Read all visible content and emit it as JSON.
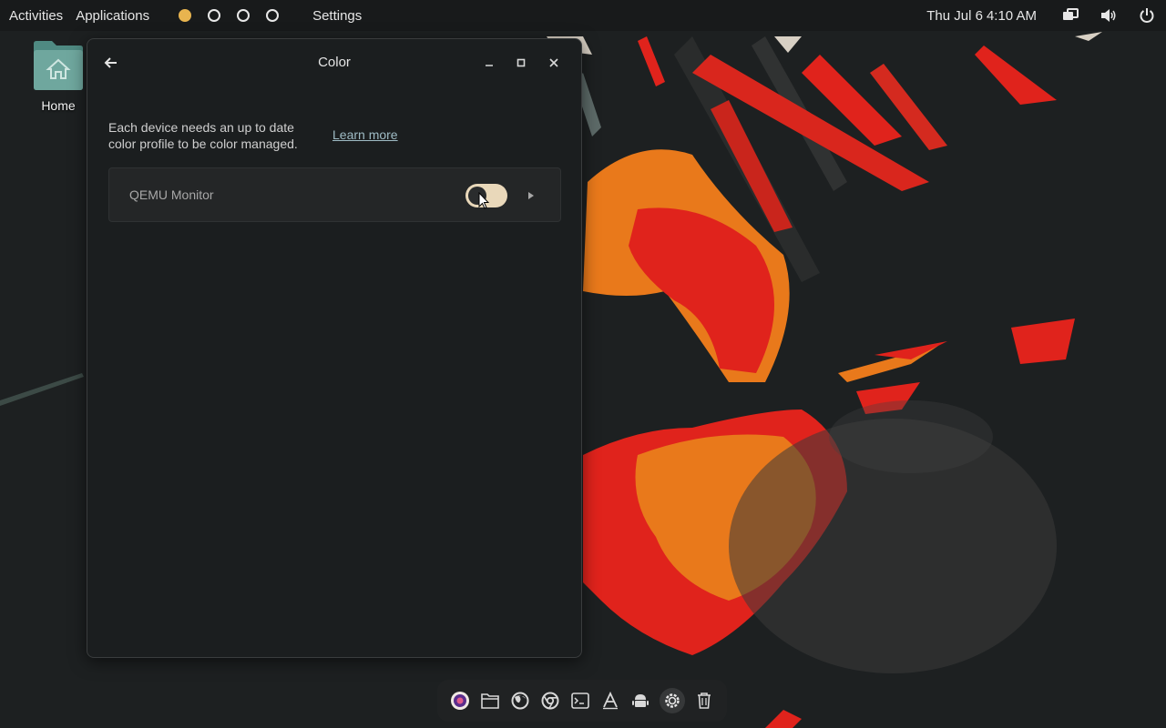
{
  "topbar": {
    "activities": "Activities",
    "applications": "Applications",
    "workspaces": [
      {
        "active": true
      },
      {
        "active": false
      },
      {
        "active": false
      },
      {
        "active": false
      }
    ],
    "active_app": "Settings",
    "date": "Thu Jul 6",
    "time": "4:10 AM",
    "status_icons": [
      "network-icon",
      "volume-icon",
      "power-icon"
    ],
    "accent_color": "#e8b44f"
  },
  "desktop": {
    "home_label": "Home"
  },
  "window": {
    "title": "Color",
    "intro_text": "Each device needs an up to date color profile to be color managed.",
    "learn_more": "Learn more",
    "devices": [
      {
        "name": "QEMU Monitor",
        "enabled": true
      }
    ]
  },
  "dock": {
    "items": [
      "app-launcher-icon",
      "files-icon",
      "firefox-icon",
      "chrome-icon",
      "terminal-icon",
      "text-editor-icon",
      "android-icon",
      "settings-icon",
      "trash-icon"
    ]
  },
  "colors": {
    "window_bg": "#1b1e1f",
    "row_bg": "#242627",
    "toggle_on": "#e9d8ba",
    "link": "#9fbcc5",
    "wallpaper_red": "#e0231c",
    "wallpaper_orange": "#e9791b"
  }
}
